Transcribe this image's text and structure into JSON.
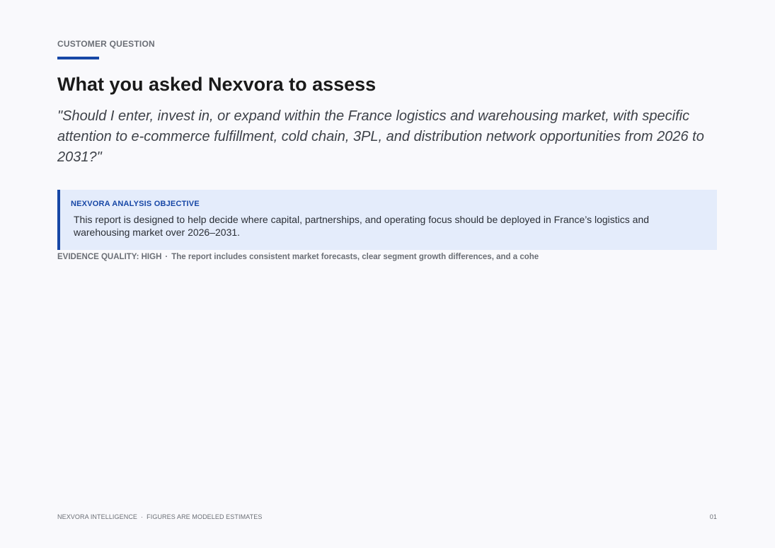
{
  "section_label": "CUSTOMER QUESTION",
  "title": "What you asked Nexvora to assess",
  "question": "\"Should I enter, invest in, or expand within the France logistics and warehousing market, with specific attention to e-commerce fulfillment, cold chain, 3PL, and distribution network opportunities from 2026 to 2031?\"",
  "objective": {
    "label": "NEXVORA ANALYSIS OBJECTIVE",
    "text": "This report is designed to help decide where capital, partnerships, and operating focus should be deployed in France’s logistics and warehousing market over 2026–2031."
  },
  "evidence": {
    "label": "EVIDENCE QUALITY: HIGH",
    "separator": "·",
    "text": "The report includes consistent market forecasts, clear segment growth differences, and a cohe"
  },
  "footer": {
    "brand": "NEXVORA INTELLIGENCE",
    "separator": "·",
    "note": "FIGURES ARE MODELED ESTIMATES",
    "page_number": "01"
  },
  "colors": {
    "accent": "#1747a6",
    "objective_background": "#e4ecfb",
    "page_background": "#f9f9fc",
    "muted_text": "#6b6f76"
  }
}
